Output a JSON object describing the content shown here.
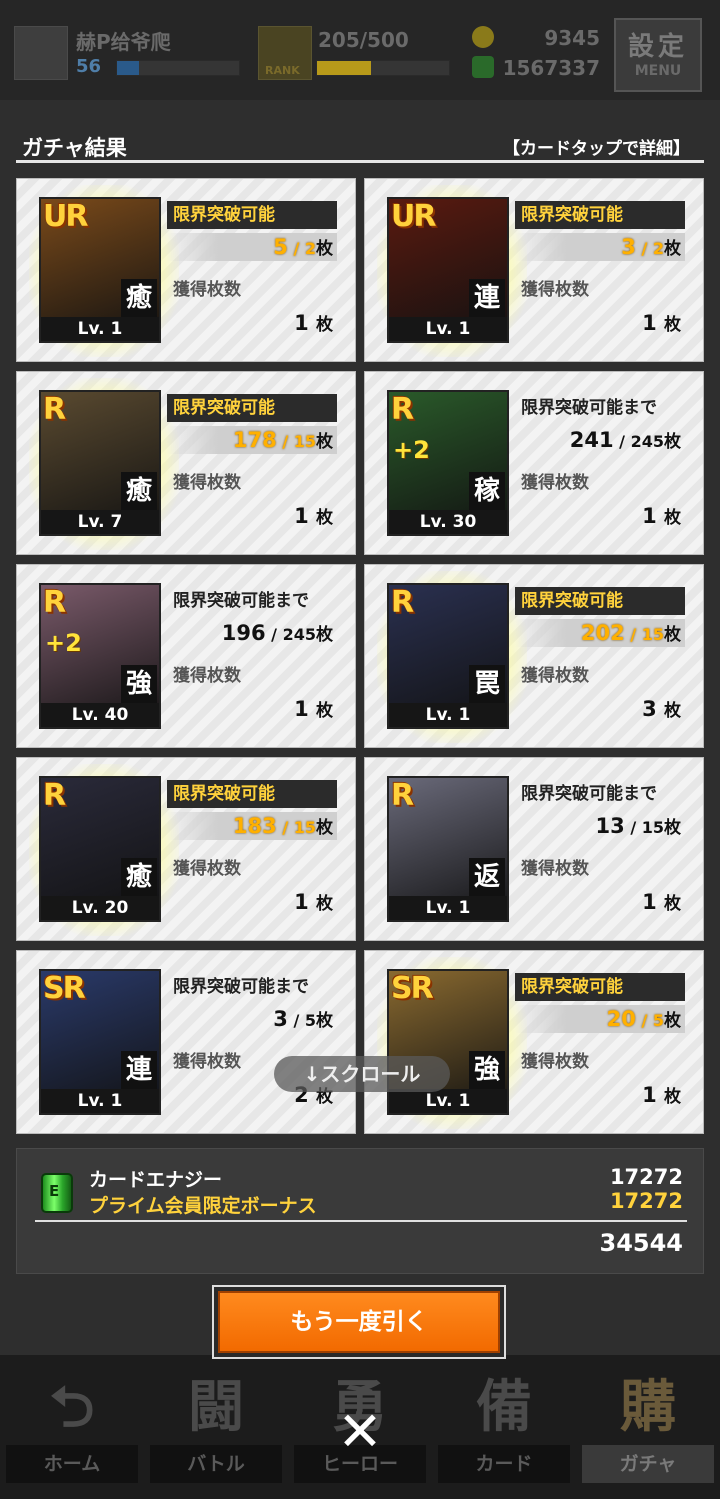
{
  "topbar": {
    "player_name": "赫P给爷爬",
    "level": "56",
    "exp": "205/500",
    "rank_label": "RANK",
    "currency1": "9345",
    "currency2": "1567337",
    "menu_big": "設定",
    "menu_small": "MENU",
    "exp_progress": 0.41
  },
  "results": {
    "title": "ガチャ結果",
    "hint": "【カードタップで詳細】",
    "cards": [
      {
        "rarity": "UR",
        "type": "癒",
        "level": "Lv. 1",
        "status": "限界突破可能",
        "limit_ok": true,
        "have": "5",
        "need": "2",
        "unit": "枚",
        "obtained_label": "獲得枚数",
        "obtained": "1",
        "art_color": "#7a4a1a"
      },
      {
        "rarity": "UR",
        "type": "連",
        "level": "Lv. 1",
        "status": "限界突破可能",
        "limit_ok": true,
        "have": "3",
        "need": "2",
        "unit": "枚",
        "obtained_label": "獲得枚数",
        "obtained": "1",
        "art_color": "#5a1a10"
      },
      {
        "rarity": "R",
        "type": "癒",
        "level": "Lv. 7",
        "status": "限界突破可能",
        "limit_ok": true,
        "have": "178",
        "need": "15",
        "unit": "枚",
        "obtained_label": "獲得枚数",
        "obtained": "1",
        "art_color": "#5a4a30"
      },
      {
        "rarity": "R",
        "type": "稼",
        "level": "Lv. 30",
        "plus": "+2",
        "status": "限界突破可能まで",
        "limit_ok": false,
        "have": "241",
        "need": "245",
        "unit": "枚",
        "obtained_label": "獲得枚数",
        "obtained": "1",
        "art_color": "#2a5a2a"
      },
      {
        "rarity": "R",
        "type": "強",
        "level": "Lv. 40",
        "plus": "+2",
        "status": "限界突破可能まで",
        "limit_ok": false,
        "have": "196",
        "need": "245",
        "unit": "枚",
        "obtained_label": "獲得枚数",
        "obtained": "1",
        "art_color": "#7a5a6a"
      },
      {
        "rarity": "R",
        "type": "罠",
        "level": "Lv. 1",
        "status": "限界突破可能",
        "limit_ok": true,
        "have": "202",
        "need": "15",
        "unit": "枚",
        "obtained_label": "獲得枚数",
        "obtained": "3",
        "art_color": "#2a3050"
      },
      {
        "rarity": "R",
        "type": "癒",
        "level": "Lv. 20",
        "status": "限界突破可能",
        "limit_ok": true,
        "have": "183",
        "need": "15",
        "unit": "枚",
        "obtained_label": "獲得枚数",
        "obtained": "1",
        "art_color": "#2a2a3a"
      },
      {
        "rarity": "R",
        "type": "返",
        "level": "Lv. 1",
        "status": "限界突破可能まで",
        "limit_ok": false,
        "have": "13",
        "need": "15",
        "unit": "枚",
        "obtained_label": "獲得枚数",
        "obtained": "1",
        "art_color": "#6a6a7a"
      },
      {
        "rarity": "SR",
        "type": "連",
        "level": "Lv. 1",
        "status": "限界突破可能まで",
        "limit_ok": false,
        "have": "3",
        "need": "5",
        "unit": "枚",
        "obtained_label": "獲得枚数",
        "obtained": "2",
        "art_color": "#2a3a6a"
      },
      {
        "rarity": "SR",
        "type": "強",
        "level": "Lv. 1",
        "status": "限界突破可能",
        "limit_ok": true,
        "have": "20",
        "need": "5",
        "unit": "枚",
        "obtained_label": "獲得枚数",
        "obtained": "1",
        "art_color": "#8a6a30"
      }
    ],
    "scroll_hint": "↓スクロール"
  },
  "energy": {
    "icon_label": "E",
    "label": "カードエナジー",
    "bonus_label": "プライム会員限定ボーナス",
    "value": "17272",
    "bonus_value": "17272",
    "total": "34544"
  },
  "again_button": "もう一度引く",
  "bottom_nav": [
    {
      "icon": "⮌",
      "label": "ホーム"
    },
    {
      "icon": "闘",
      "label": "バトル"
    },
    {
      "icon": "勇",
      "label": "ヒーロー"
    },
    {
      "icon": "備",
      "label": "カード"
    },
    {
      "icon": "購",
      "label": "ガチャ"
    }
  ],
  "close_glyph": "✕",
  "colors": {
    "accent_orange": "#f26a00",
    "gold_text": "#ffd23c",
    "count_orange": "#ffb000"
  }
}
